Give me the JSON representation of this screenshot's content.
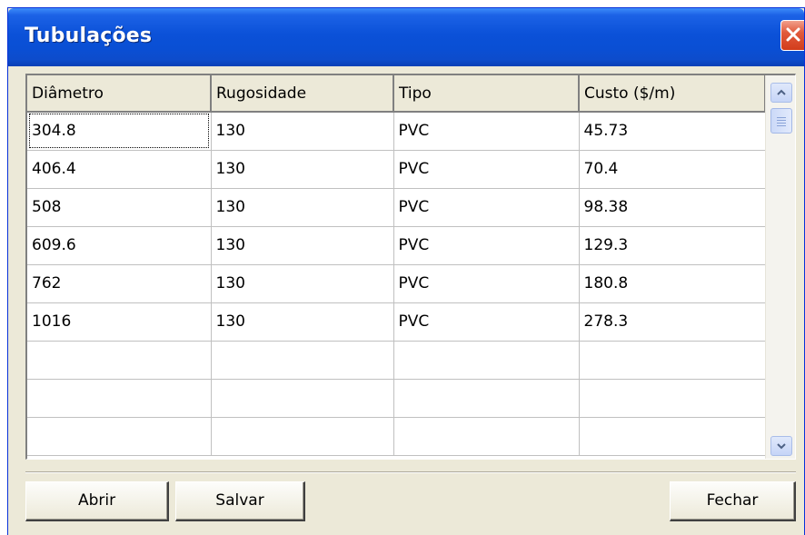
{
  "window": {
    "title": "Tubulações",
    "close_icon": "close-x-icon"
  },
  "grid": {
    "columns": [
      "Diâmetro",
      "Rugosidade",
      "Tipo",
      "Custo ($/m)"
    ],
    "rows": [
      [
        "304.8",
        "130",
        "PVC",
        "45.73"
      ],
      [
        "406.4",
        "130",
        "PVC",
        "70.4"
      ],
      [
        "508",
        "130",
        "PVC",
        "98.38"
      ],
      [
        "609.6",
        "130",
        "PVC",
        "129.3"
      ],
      [
        "762",
        "130",
        "PVC",
        "180.8"
      ],
      [
        "1016",
        "130",
        "PVC",
        "278.3"
      ],
      [
        "",
        "",
        "",
        ""
      ],
      [
        "",
        "",
        "",
        ""
      ],
      [
        "",
        "",
        "",
        ""
      ]
    ]
  },
  "scrollbar": {
    "up_icon": "scroll-up-arrow-icon",
    "down_icon": "scroll-down-arrow-icon"
  },
  "buttons": {
    "open_label": "Abrir",
    "save_label": "Salvar",
    "close_label": "Fechar"
  }
}
